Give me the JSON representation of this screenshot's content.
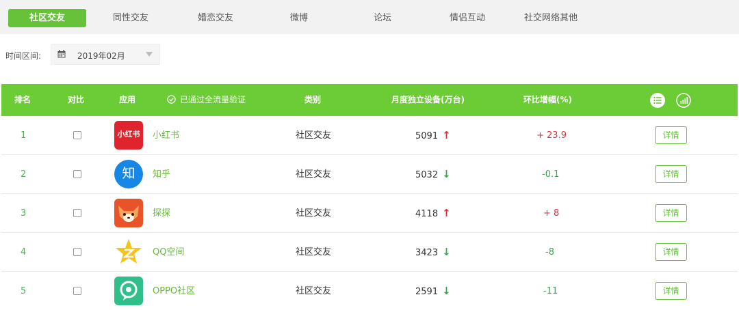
{
  "tabs": [
    {
      "label": "社区交友",
      "active": true
    },
    {
      "label": "同性交友",
      "active": false
    },
    {
      "label": "婚恋交友",
      "active": false
    },
    {
      "label": "微博",
      "active": false
    },
    {
      "label": "论坛",
      "active": false
    },
    {
      "label": "情侣互动",
      "active": false
    },
    {
      "label": "社交网络其他",
      "active": false
    }
  ],
  "filter": {
    "label": "时间区间:",
    "date": "2019年02月",
    "calendar_icon": "calendar-icon",
    "dropdown_icon": "caret-down-icon"
  },
  "table": {
    "headers": {
      "rank": "排名",
      "compare": "对比",
      "app": "应用",
      "verified": "已通过全流量验证",
      "category": "类别",
      "devices": "月度独立设备(万台)",
      "change": "环比增幅(%)"
    },
    "header_icons": [
      "list-view-icon",
      "chart-view-icon"
    ],
    "detail_label": "详情",
    "rows": [
      {
        "rank": "1",
        "app": "小红书",
        "icon": "xiaohongshu-logo",
        "icon_text": "小红书",
        "category": "社区交友",
        "devices": "5091",
        "trend": "up",
        "change": "+ 23.9"
      },
      {
        "rank": "2",
        "app": "知乎",
        "icon": "zhihu-logo",
        "icon_text": "知",
        "category": "社区交友",
        "devices": "5032",
        "trend": "down",
        "change": "-0.1"
      },
      {
        "rank": "3",
        "app": "探探",
        "icon": "tantan-logo",
        "icon_text": "",
        "category": "社区交友",
        "devices": "4118",
        "trend": "up",
        "change": "+ 8"
      },
      {
        "rank": "4",
        "app": "QQ空间",
        "icon": "qzone-logo",
        "icon_text": "",
        "category": "社区交友",
        "devices": "3423",
        "trend": "down",
        "change": "-8"
      },
      {
        "rank": "5",
        "app": "OPPO社区",
        "icon": "oppo-community-logo",
        "icon_text": "",
        "category": "社区交友",
        "devices": "2591",
        "trend": "down",
        "change": "-11"
      }
    ]
  },
  "colors": {
    "accent": "#67c23a",
    "header_bg": "#6ccc36",
    "up": "#d9363e",
    "down": "#3aa84c"
  }
}
